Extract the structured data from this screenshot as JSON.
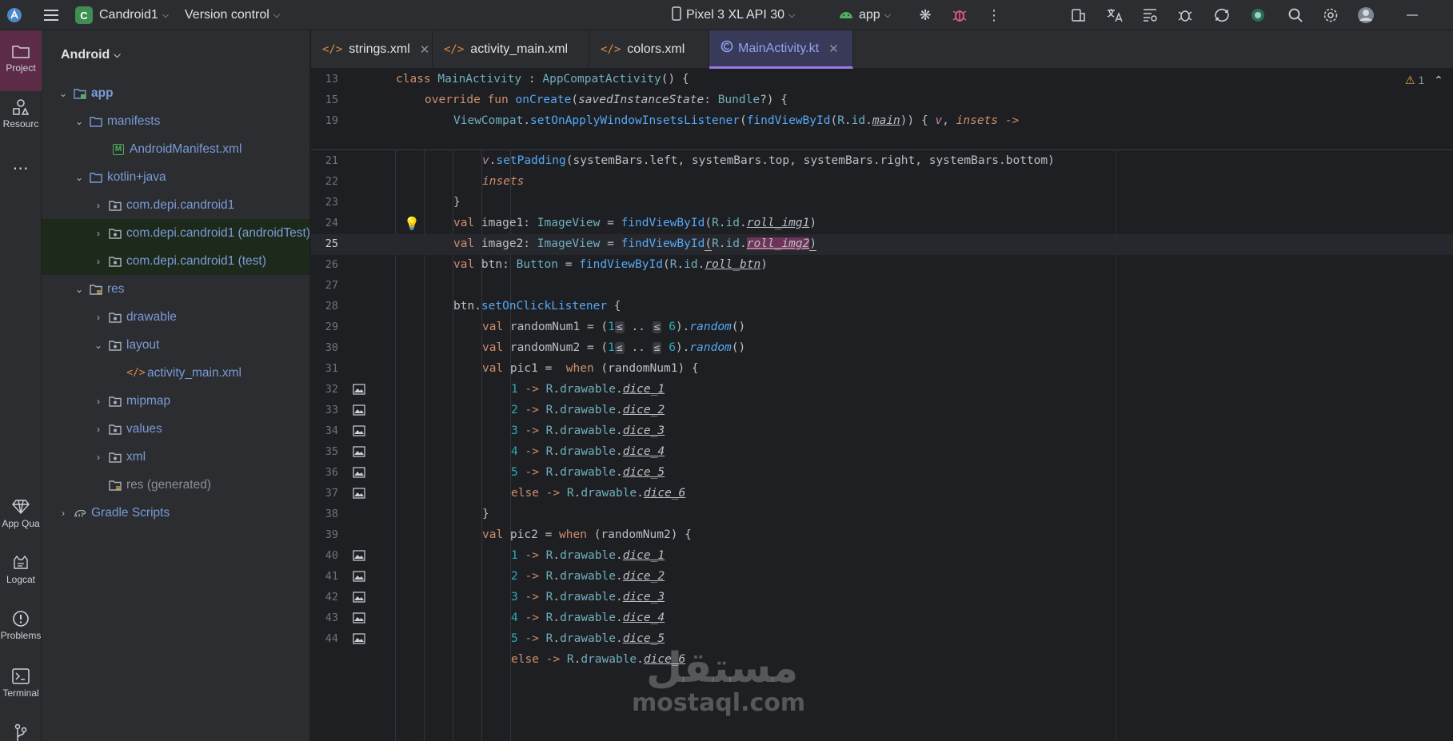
{
  "toolbar": {
    "project_initial": "C",
    "project_name": "Candroid1",
    "vcs_label": "Version control",
    "device_label": "Pixel 3 XL API 30",
    "run_config": "app"
  },
  "toolstrip": {
    "project": "Project",
    "resource": "Resourc",
    "app_quality": "App Qua",
    "logcat": "Logcat",
    "problems": "Problems",
    "terminal": "Terminal"
  },
  "project_panel": {
    "view_mode": "Android",
    "tree": [
      {
        "label": "app"
      },
      {
        "label": "manifests"
      },
      {
        "label": "AndroidManifest.xml"
      },
      {
        "label": "kotlin+java"
      },
      {
        "label": "com.depi.candroid1"
      },
      {
        "label": "com.depi.candroid1 (androidTest)"
      },
      {
        "label": "com.depi.candroid1 (test)"
      },
      {
        "label": "res"
      },
      {
        "label": "drawable"
      },
      {
        "label": "layout"
      },
      {
        "label": "activity_main.xml"
      },
      {
        "label": "mipmap"
      },
      {
        "label": "values"
      },
      {
        "label": "xml"
      },
      {
        "label": "res (generated)"
      },
      {
        "label": "Gradle Scripts"
      }
    ]
  },
  "tabs": [
    {
      "label": "strings.xml"
    },
    {
      "label": "activity_main.xml"
    },
    {
      "label": "colors.xml"
    },
    {
      "label": "MainActivity.kt"
    }
  ],
  "editor": {
    "warning_count": "1",
    "line_numbers": [
      "13",
      "15",
      "19",
      "21",
      "22",
      "23",
      "24",
      "25",
      "26",
      "27",
      "28",
      "29",
      "30",
      "31",
      "32",
      "33",
      "34",
      "35",
      "36",
      "37",
      "38",
      "39",
      "40",
      "41",
      "42",
      "43",
      "44"
    ]
  },
  "watermark": {
    "arabic": "مستقل",
    "latin": "mostaql.com"
  }
}
